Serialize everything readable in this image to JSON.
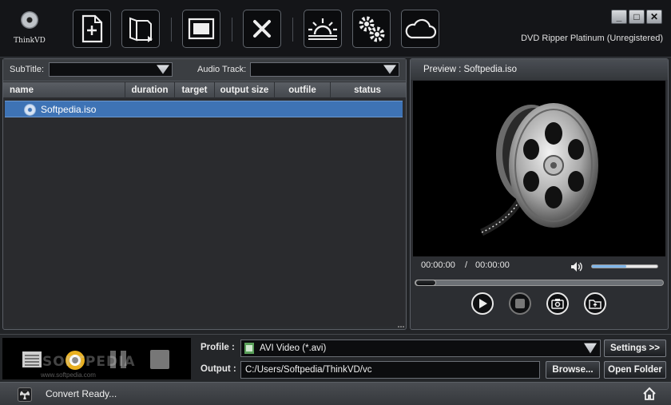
{
  "app": {
    "logo_text": "ThinkVD",
    "title": "DVD Ripper Platinum (Unregistered)"
  },
  "toolbar": {
    "buttons": [
      "add-file",
      "add-folder",
      "fullscreen",
      "remove",
      "sunrise",
      "settings",
      "cloud"
    ]
  },
  "window_controls": {
    "minimize": "_",
    "maximize": "□",
    "close": "✕"
  },
  "tracks": {
    "subtitle_label": "SubTitle:",
    "subtitle_value": "",
    "audio_label": "Audio Track:",
    "audio_value": ""
  },
  "file_list": {
    "columns": [
      "name",
      "duration",
      "target",
      "output size",
      "outfile",
      "status"
    ],
    "rows": [
      {
        "name": "Softpedia.iso",
        "duration": "",
        "target": "",
        "output_size": "",
        "outfile": "",
        "status": ""
      }
    ]
  },
  "preview": {
    "title": "Preview : Softpedia.iso",
    "current_time": "00:00:00",
    "separator": "/",
    "total_time": "00:00:00",
    "volume_fraction": 0.52,
    "seek_fraction": 0.0
  },
  "output": {
    "profile_label": "Profile :",
    "profile_value": "AVI Video (*.avi)",
    "output_label": "Output :",
    "output_path": "C:/Users/Softpedia/ThinkVD/vc",
    "settings_button": "Settings >>",
    "browse_button": "Browse...",
    "open_folder_button": "Open Folder"
  },
  "watermark": {
    "text": "SOFTPEDIA",
    "url": "www.softpedia.com"
  },
  "status": {
    "text": "Convert Ready..."
  },
  "colors": {
    "selection": "#3e73b5",
    "accent": "#7fb6ea",
    "background": "#222427"
  }
}
